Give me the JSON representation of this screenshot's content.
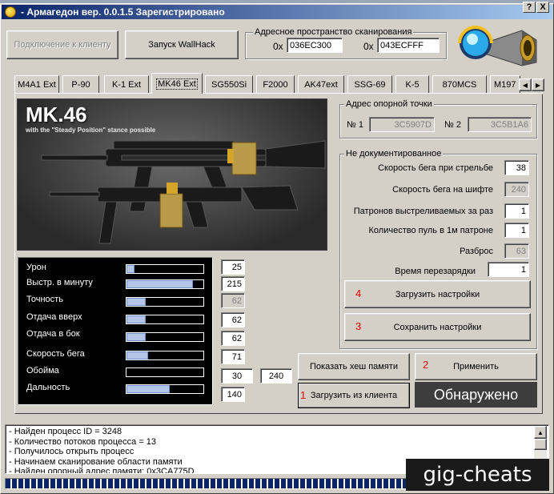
{
  "window": {
    "title": "- Армагедон вер. 0.0.1.5  Зарегистрировано",
    "help_label": "?",
    "close_label": "X"
  },
  "toolbar": {
    "connect_label": "Подключение к клиенту",
    "wallhack_label": "Запуск WallHack"
  },
  "scan": {
    "group_title": "Адресное пространство сканирования",
    "prefix": "0x",
    "start": "036EC300",
    "end": "043ECFFF"
  },
  "tabs": [
    {
      "label": "M4A1 Ext"
    },
    {
      "label": "P-90"
    },
    {
      "label": "K-1 Ext"
    },
    {
      "label": "MK46 Ext"
    },
    {
      "label": "SG550Si"
    },
    {
      "label": "F2000"
    },
    {
      "label": "AK47ext"
    },
    {
      "label": "SSG-69"
    },
    {
      "label": "K-5"
    },
    {
      "label": "870MCS"
    },
    {
      "label": "M197"
    }
  ],
  "weapon": {
    "title": "MK.46",
    "subtitle": "with the \"Steady Position\" stance possible"
  },
  "anchor": {
    "group_title": "Адрес опорной точки",
    "n1_label": "№ 1",
    "n1_value": "3C5907D",
    "n2_label": "№ 2",
    "n2_value": "3C5B1A6"
  },
  "undocumented": {
    "group_title": "Не документированное",
    "rows": [
      {
        "label": "Скорость бега при стрельбе",
        "value": "38"
      },
      {
        "label": "Скорость бега на шифте",
        "value": "240"
      },
      {
        "label": "Патронов выстреливаемых за раз",
        "value": "1"
      },
      {
        "label": "Количество пуль в 1м патроне",
        "value": "1"
      },
      {
        "label": "Разброс",
        "value": "63"
      },
      {
        "label": "Время перезарядки",
        "value": "1"
      }
    ]
  },
  "stats": [
    {
      "label": "Урон",
      "value": "25",
      "fill": 0.1
    },
    {
      "label": "Выстр. в минуту",
      "value": "215",
      "fill": 0.86
    },
    {
      "label": "Точность",
      "value": "62",
      "fill": 0.25
    },
    {
      "label": "Отдача вверх",
      "value": "62",
      "fill": 0.25
    },
    {
      "label": "Отдача в бок",
      "value": "62",
      "fill": 0.25
    },
    {
      "label": "Скорость бега",
      "value": "71",
      "fill": 0.28
    },
    {
      "label": "Обойма",
      "value": "30",
      "value2": "240",
      "fill": 0
    },
    {
      "label": "Дальность",
      "value": "140",
      "fill": 0.56
    }
  ],
  "actions": {
    "load_settings": "Загрузить настройки",
    "load_num": "4",
    "save_settings": "Сохранить настройки",
    "save_num": "3",
    "show_hash": "Показать хеш памяти",
    "apply": "Применить",
    "apply_num": "2",
    "load_client": "Загрузить из клиента",
    "load_client_num": "1",
    "status": "Обнаружено"
  },
  "log": [
    "- Найден процесс ID = 3248",
    "- Количество потоков процесса = 13",
    "- Получилось открыть процесс",
    "- Начинаем сканирование области памяти",
    "- Найден опорный адрес памяти: 0x3CA775D"
  ],
  "watermark": "gig-cheats",
  "colors": {
    "title_start": "#0a246a",
    "title_end": "#a6caf0",
    "bar_fill": "#b3c6e7",
    "marker_red": "#e00000"
  }
}
